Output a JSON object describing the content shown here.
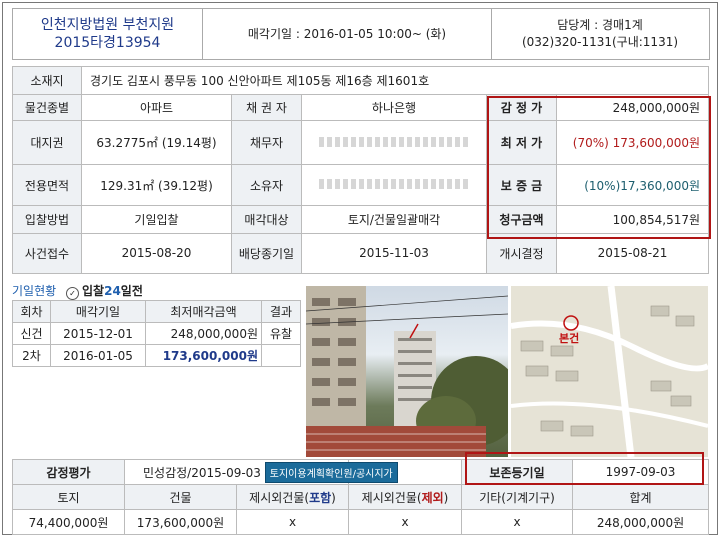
{
  "header": {
    "court": "인천지방법원 부천지원",
    "case_no": "2015타경13954",
    "auction_date": "매각기일 : 2016-01-05   10:00~ (화)",
    "dept": "담당계 : 경매1계",
    "phone": "(032)320-1131(구내:1131)"
  },
  "info": {
    "address_label": "소재지",
    "address": "경기도 김포시 풍무동 100 신안아파트 제105동 제16층 제1601호",
    "type_label": "물건종별",
    "type": "아파트",
    "creditor_label": "채 권 자",
    "creditor": "하나은행",
    "appraisal_label": "감 정 가",
    "appraisal": "248,000,000원",
    "land_right_label": "대지권",
    "land_right": "63.2775㎡ (19.14평)",
    "debtor_label": "채무자",
    "min_price_label": "최 저 가",
    "min_price": "(70%) 173,600,000원",
    "area_label": "전용면적",
    "area": "129.31㎡ (39.12평)",
    "owner_label": "소유자",
    "deposit_label": "보 증 금",
    "deposit": "(10%)17,360,000원",
    "bid_method_label": "입찰방법",
    "bid_method": "기일입찰",
    "sale_target_label": "매각대상",
    "sale_target": "토지/건물일괄매각",
    "claim_label": "청구금액",
    "claim": "100,854,517원",
    "received_label": "사건접수",
    "received": "2015-08-20",
    "dividend_label": "배당종기일",
    "dividend": "2015-11-03",
    "start_label": "개시결정",
    "start": "2015-08-21"
  },
  "history": {
    "title": "기일현황",
    "badge_pre": "입찰",
    "badge_days": "24",
    "badge_post": "일전",
    "columns": [
      "회차",
      "매각기일",
      "최저매각금액",
      "결과"
    ],
    "rows": [
      {
        "round": "신건",
        "date": "2015-12-01",
        "price": "248,000,000원",
        "result": "유찰"
      },
      {
        "round": "2차",
        "date": "2016-01-05",
        "price": "173,600,000원",
        "result": ""
      }
    ]
  },
  "map": {
    "marker": "본건"
  },
  "bottom": {
    "appraisal_label": "감정평가",
    "appraisal_value": "민성감정/2015-09-03",
    "plan_button": "토지이용계획확인원/공시지가",
    "preserve_label": "보존등기일",
    "preserve_date": "1997-09-03",
    "columns": {
      "land": "토지",
      "building": "건물",
      "incl_pre": "제시외건물(",
      "incl": "포함",
      "excl_pre": "제시외건물(",
      "excl": "제외",
      "etc": "기타(기계기구)",
      "total": "합계",
      "close": ")"
    },
    "values": {
      "land": "74,400,000원",
      "building": "173,600,000원",
      "incl": "x",
      "excl": "x",
      "etc": "x",
      "total": "248,000,000원"
    }
  }
}
